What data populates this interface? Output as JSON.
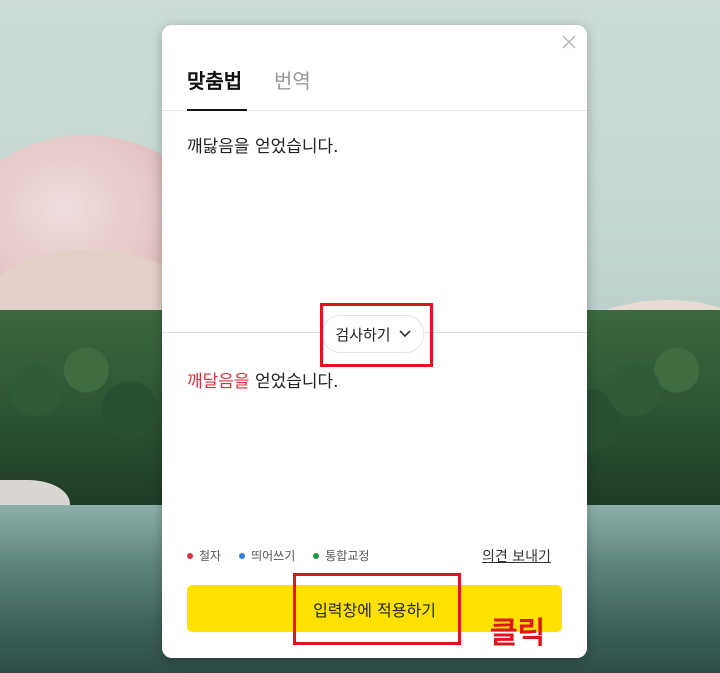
{
  "panel": {
    "tabs": [
      {
        "label": "맞춤법",
        "active": true
      },
      {
        "label": "번역",
        "active": false
      }
    ],
    "input_text": "깨닳음을 얻었습니다.",
    "check_button_label": "검사하기",
    "result": {
      "error_text": "깨달음을",
      "rest_text": " 얻었습니다."
    },
    "legend": [
      {
        "label": "철자",
        "color": "#d8313a"
      },
      {
        "label": "띄어쓰기",
        "color": "#2f7fdc"
      },
      {
        "label": "통합교정",
        "color": "#1a9a3a"
      }
    ],
    "feedback_link": "의견 보내기",
    "apply_button_label": "입력창에 적용하기"
  },
  "annotation": {
    "click_label": "클릭",
    "color": "#e0161c"
  },
  "icons": {
    "close": "close-icon",
    "chevron": "chevron-down-icon"
  }
}
